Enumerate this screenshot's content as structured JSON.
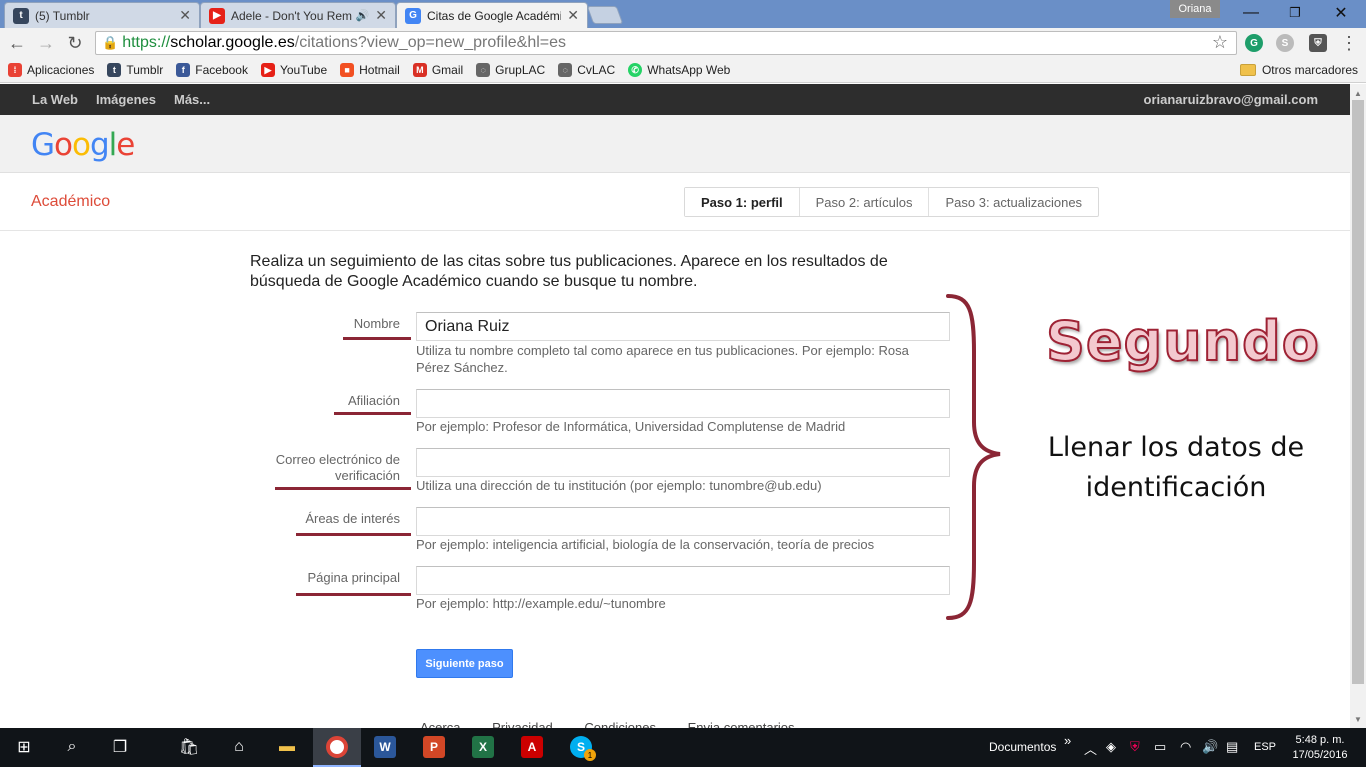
{
  "browser": {
    "tabs": [
      {
        "title": "(5) Tumblr",
        "favicon": "tumblr-icon",
        "color": "#36465d",
        "glyph": "t"
      },
      {
        "title": "Adele - Don't You Rem",
        "favicon": "youtube-icon",
        "color": "#e62117",
        "glyph": "▶"
      },
      {
        "title": "Citas de Google Académic",
        "favicon": "scholar-icon",
        "color": "#4285f4",
        "glyph": "G"
      }
    ],
    "user_badge": "Oriana",
    "url": {
      "scheme": "https://",
      "host": "scholar.google.es",
      "path": "/citations?view_op=new_profile&hl=es"
    },
    "bookmarks": [
      {
        "label": "Aplicaciones",
        "icon": "apps-grid-icon",
        "color": "#e94235",
        "glyph": "⁞"
      },
      {
        "label": "Tumblr",
        "icon": "tumblr-icon",
        "color": "#36465d",
        "glyph": "t"
      },
      {
        "label": "Facebook",
        "icon": "facebook-icon",
        "color": "#3b5998",
        "glyph": "f"
      },
      {
        "label": "YouTube",
        "icon": "youtube-icon",
        "color": "#e62117",
        "glyph": "▶"
      },
      {
        "label": "Hotmail",
        "icon": "windows-icon",
        "color": "#f25022",
        "glyph": "■"
      },
      {
        "label": "Gmail",
        "icon": "gmail-icon",
        "color": "#d93025",
        "glyph": "M"
      },
      {
        "label": "GrupLAC",
        "icon": "gruplac-icon",
        "color": "#666666",
        "glyph": "◌"
      },
      {
        "label": "CvLAC",
        "icon": "cvlac-icon",
        "color": "#666666",
        "glyph": "◌"
      },
      {
        "label": "WhatsApp Web",
        "icon": "whatsapp-icon",
        "color": "#25d366",
        "glyph": "✆"
      }
    ],
    "other_bookmarks": "Otros marcadores"
  },
  "gbar": {
    "items": [
      "La Web",
      "Imágenes",
      "Más..."
    ],
    "email": "orianaruizbravo@gmail.com"
  },
  "header": {
    "logo_letters": [
      {
        "ch": "G",
        "color": "#4285f4"
      },
      {
        "ch": "o",
        "color": "#ea4335"
      },
      {
        "ch": "o",
        "color": "#fbbc05"
      },
      {
        "ch": "g",
        "color": "#4285f4"
      },
      {
        "ch": "l",
        "color": "#34a853"
      },
      {
        "ch": "e",
        "color": "#ea4335"
      }
    ],
    "section": "Académico",
    "steps": [
      "Paso 1: perfil",
      "Paso 2: artículos",
      "Paso 3: actualizaciones"
    ]
  },
  "form": {
    "intro": "Realiza un seguimiento de las citas sobre tus publicaciones. Aparece en los resultados de búsqueda de Google Académico cuando se busque tu nombre.",
    "name": {
      "label": "Nombre",
      "value": "Oriana Ruiz",
      "hint": "Utiliza tu nombre completo tal como aparece en tus publicaciones. Por ejemplo: Rosa Pérez Sánchez."
    },
    "affiliation": {
      "label": "Afiliación",
      "value": "",
      "hint": "Por ejemplo: Profesor de Informática, Universidad Complutense de Madrid"
    },
    "email": {
      "label_line1": "Correo electrónico de",
      "label_line2": "verificación",
      "value": "",
      "hint": "Utiliza una dirección de tu institución (por ejemplo: tunombre@ub.edu)"
    },
    "interests": {
      "label": "Áreas de interés",
      "value": "",
      "hint": "Por ejemplo: inteligencia artificial, biología de la conservación, teoría de precios"
    },
    "homepage": {
      "label": "Página principal",
      "value": "",
      "hint": "Por ejemplo: http://example.edu/~tunombre"
    },
    "next_button": "Siguiente paso",
    "footer_links": [
      "Acerca",
      "Privacidad",
      "Condiciones",
      "Envia comentarios"
    ]
  },
  "annotation": {
    "title": "Segundo",
    "text_line1": "Llenar los datos de",
    "text_line2": "identificación",
    "accent_color": "#8b2635"
  },
  "taskbar": {
    "documents": "Documentos",
    "lang": "ESP",
    "time": "5:48 p. m.",
    "date": "17/05/2016",
    "skype_badge": "1"
  }
}
